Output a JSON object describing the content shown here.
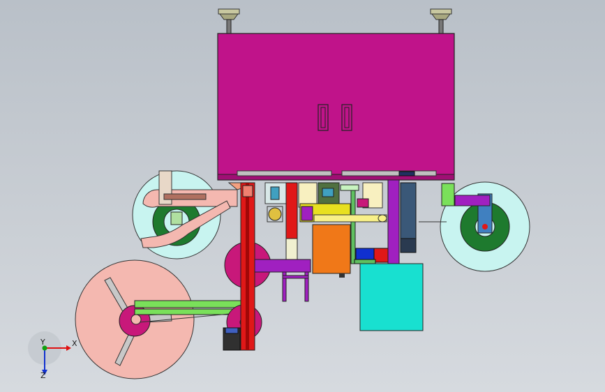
{
  "viewport": {
    "background_top": "#b9c0c8",
    "background_bottom": "#d6dadf"
  },
  "triad": {
    "x_label": "X",
    "y_label": "Y",
    "z_label": "Z",
    "x_color": "#e01010",
    "y_color": "#10a010",
    "z_color": "#1030d0"
  },
  "colors": {
    "cabinet": "#c0138a",
    "reel_light": "#c8f4f0",
    "reel_green": "#1e7a2e",
    "reel_salmon": "#f4b8b0",
    "reel_magenta": "#c8187a",
    "red_rail": "#e01818",
    "green_bar": "#7ae05a",
    "orange_box": "#f07818",
    "cyan_box": "#18e0d0",
    "purple_arm": "#a020c0"
  }
}
